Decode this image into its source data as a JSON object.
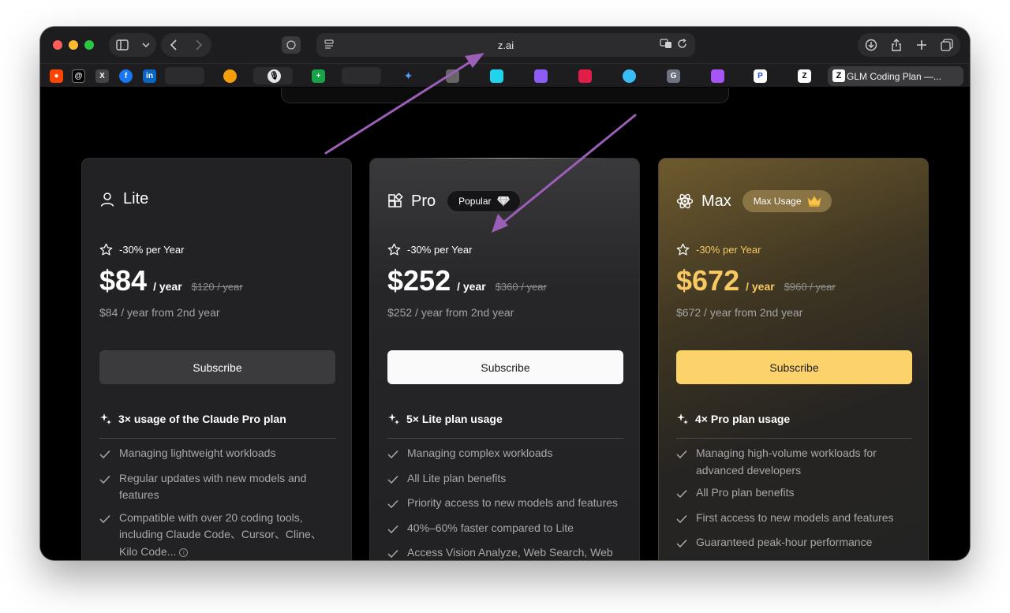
{
  "browser": {
    "url": "z.ai",
    "active_tab_title": "GLM Coding Plan —...",
    "bookmarks": [
      "reddit-icon",
      "threads-icon",
      "x-icon",
      "facebook-icon",
      "linkedin-icon"
    ]
  },
  "plans": [
    {
      "name": "Lite",
      "badge": "",
      "discount": "-30% per Year",
      "price": "$84",
      "per": "/ year",
      "original": "$120 / year",
      "renewal": "$84 / year from 2nd year",
      "cta": "Subscribe",
      "feature_title": "3× usage of the Claude Pro plan",
      "features": [
        "Managing lightweight workloads",
        "Regular updates with new models and features",
        "Compatible with over 20 coding tools, including Claude Code、Cursor、Cline、Kilo Code..."
      ]
    },
    {
      "name": "Pro",
      "badge": "Popular",
      "discount": "-30% per Year",
      "price": "$252",
      "per": "/ year",
      "original": "$360 / year",
      "renewal": "$252 / year from 2nd year",
      "cta": "Subscribe",
      "feature_title": "5× Lite plan usage",
      "features": [
        "Managing complex workloads",
        "All Lite plan benefits",
        "Priority access to new models and features",
        "40%–60% faster compared to Lite",
        "Access Vision Analyze, Web Search, Web Reader and Zread MCP"
      ]
    },
    {
      "name": "Max",
      "badge": "Max Usage",
      "discount": "-30% per Year",
      "price": "$672",
      "per": "/ year",
      "original": "$960 / year",
      "renewal": "$672 / year from 2nd year",
      "cta": "Subscribe",
      "feature_title": "4× Pro plan usage",
      "features": [
        "Managing high-volume workloads for advanced developers",
        "All Pro plan benefits",
        "First access to new models and features",
        "Guaranteed peak-hour performance"
      ]
    }
  ],
  "colors": {
    "accent_gold": "#f8c863",
    "max_button": "#fcd26b",
    "annotation_arrow": "#9b5fb8"
  }
}
